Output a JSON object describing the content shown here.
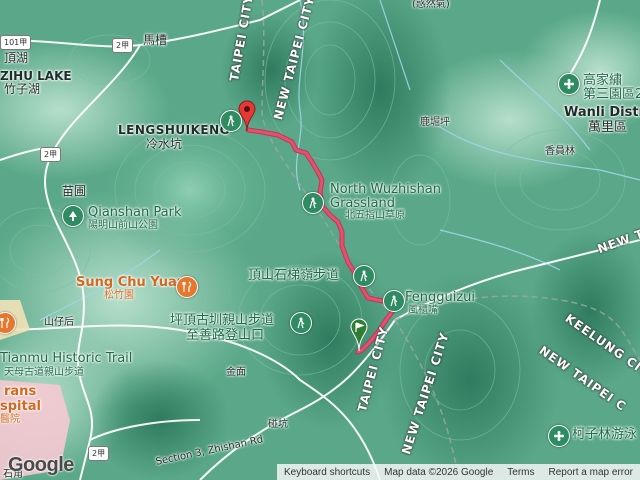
{
  "labels": {
    "taipei_city_top": "TAIPEI CITY",
    "new_taipei_city_top": "NEW TAIPEI CITY",
    "lengshuikeng_en": "LENGSHUIKENG",
    "lengshuikeng_zh": "冷水坑",
    "mazao": "馬槽",
    "dinghu": "頂湖",
    "zhizi_lake_en": "ZIHU LAKE",
    "zhizi_lake_zh": "竹子湖",
    "miaopu": "苗圃",
    "qianshan_park_en": "Qianshan Park",
    "qianshan_park_zh": "陽明山前山公園",
    "luku_ping": "鹿堀坪",
    "xiangyuanlin": "香員林",
    "gaojia_1": "高家繡",
    "gaojia_2": "第三園區2",
    "wanli_en": "Wanli Distric",
    "wanli_zh": "萬里區",
    "north_wuzhishan_en_1": "North Wuzhishan",
    "north_wuzhishan_en_2": "Grassland",
    "north_wuzhishan_zh": "北五指山草原",
    "dingshan_trail": "頂山石梯嶺步道",
    "fengguizui_en": "Fengguizui",
    "fengguizui_zh": "風櫃嘴",
    "sung_chu_yuan_en": "Sung Chu Yuan",
    "sung_chu_yuan_zh": "松竹園",
    "pingding_1": "坪頂古圳親山步道",
    "pingding_2": "至善路登山口",
    "shanzihou": "山仔后",
    "tianmu_en": "Tianmu Historic Trail",
    "tianmu_zh": "天母古道親山步道",
    "jinmian": "金面",
    "bikeng": "碰坑",
    "taipei_city_bottom": "TAIPEI CITY",
    "new_taipei_city_bottom": "NEW TAIPEI CITY",
    "new_taipei_right_1": "NEW TA",
    "keelung_city": "KEELUNG CIT",
    "new_taipei_right_2": "NEW TAIPEI C",
    "kezilin": "柯子林游泳",
    "zhishan_rd": "Section 3, Zhishan Rd",
    "trans_1": "rans",
    "trans_2": "spital",
    "trans_3": "醫院",
    "shijiao": "石角",
    "top_right_text": "(惑然氣)"
  },
  "road_shields": {
    "r101": "101甲",
    "r2_top": "2甲",
    "r2_mid": "2甲",
    "r2_bottom": "2甲"
  },
  "footer": {
    "keyboard": "Keyboard shortcuts",
    "map_data": "Map data ©2026 Google",
    "terms": "Terms",
    "report": "Report a map error"
  },
  "logo": "Google",
  "colors": {
    "route": "#e5506f",
    "terrain": "#5aa889",
    "marker_end": "#e53935",
    "marker_start": "#2e7d32"
  },
  "icons": {
    "start_marker": "flag-marker-icon",
    "end_marker": "red-pin-marker-icon",
    "park": "tree-icon",
    "hiking": "hiking-icon",
    "restaurant": "fork-knife-icon",
    "flower": "flower-icon"
  }
}
